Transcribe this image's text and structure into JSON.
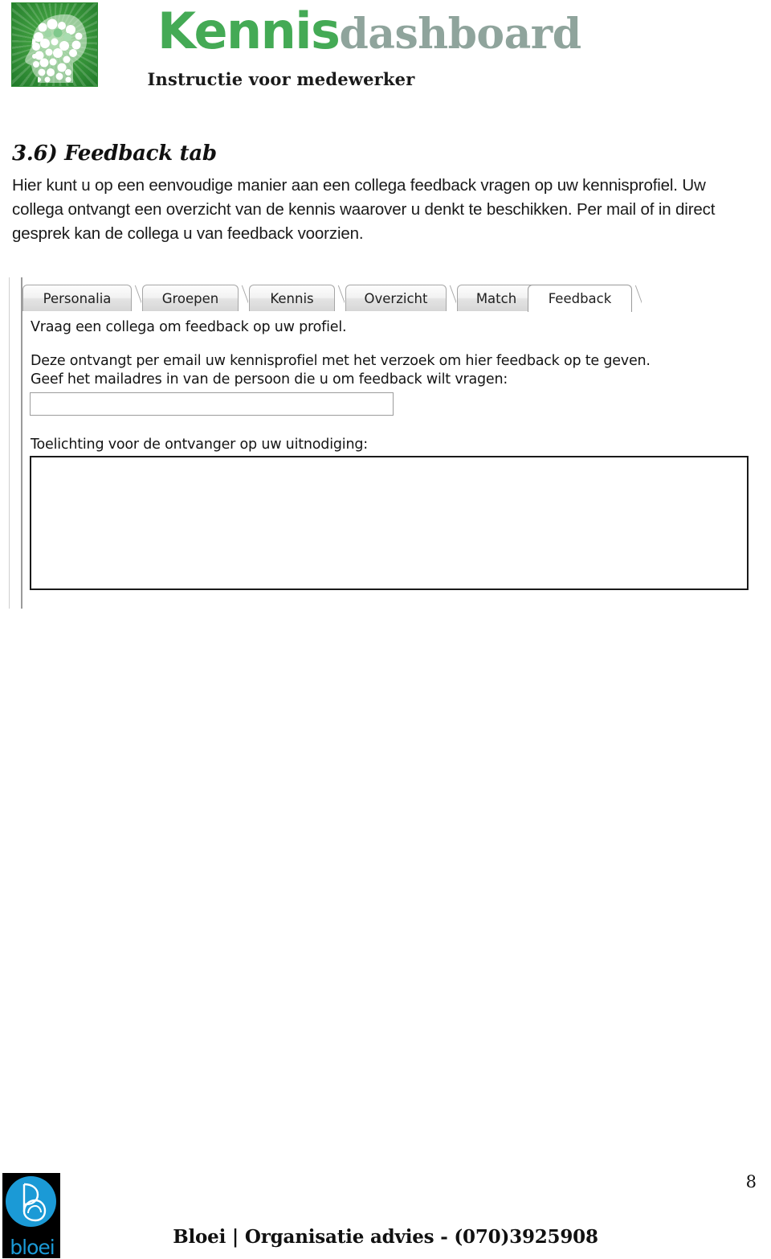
{
  "header": {
    "brand_primary": "Kennis",
    "brand_secondary": "dashboard",
    "subtitle": "Instructie voor medewerker",
    "brand_primary_color": "#44aa55",
    "brand_secondary_color": "#8fa49c",
    "logo_icon": "brain-head-icon"
  },
  "document": {
    "section_heading": "3.6) Feedback tab",
    "intro_paragraph": "Hier kunt u op een eenvoudige manier aan een collega feedback vragen op uw kennisprofiel. Uw collega ontvangt een overzicht van de kennis waarover u denkt te beschikken. Per mail of in direct gesprek kan de collega u van feedback voorzien."
  },
  "app": {
    "tabs": [
      {
        "label": "Personalia",
        "active": false
      },
      {
        "label": "Groepen",
        "active": false
      },
      {
        "label": "Kennis",
        "active": false
      },
      {
        "label": "Overzicht",
        "active": false
      },
      {
        "label": "Match",
        "active": false
      },
      {
        "label": "Feedback",
        "active": true
      }
    ],
    "line_1": "Vraag een collega om feedback op uw profiel.",
    "line_2": "Deze ontvangt per email uw kennisprofiel met het verzoek om hier feedback op te geven.",
    "line_3": "Geef het mailadres in van de persoon die u om feedback wilt vragen:",
    "email_value": "",
    "email_placeholder": "",
    "toelichting_label": "Toelichting voor de ontvanger op uw uitnodiging:",
    "toelichting_value": "",
    "toelichting_placeholder": ""
  },
  "footer": {
    "company_line": "Bloei | Organisatie advies -  (070)3925908",
    "logo_wordmark": "bloei",
    "logo_icon": "bloei-droplet-icon",
    "logo_accent_color": "#1b9ad6",
    "page_number": "8"
  }
}
